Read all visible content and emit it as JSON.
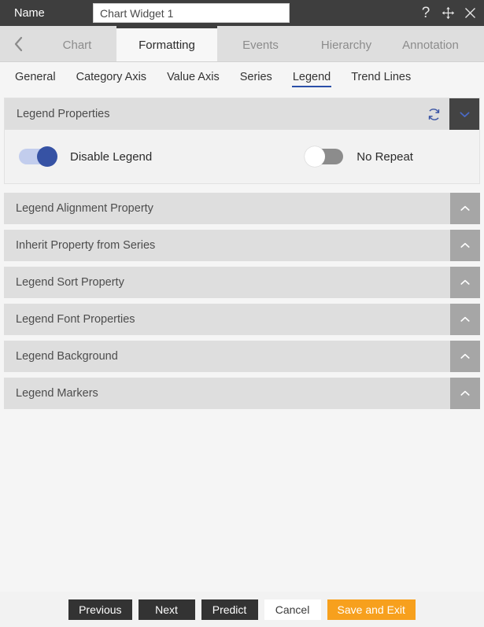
{
  "titlebar": {
    "name_label": "Name",
    "widget_name": "Chart Widget 1",
    "widget_name_placeholder": "Chart Widget 1",
    "icons": {
      "help": "?",
      "move": "move-icon",
      "close": "close-icon"
    }
  },
  "tabs": {
    "prev_arrow": "chevron-left-icon",
    "next_arrow": "chevron-right-icon",
    "items": [
      {
        "label": "Chart",
        "active": false
      },
      {
        "label": "Formatting",
        "active": true
      },
      {
        "label": "Events",
        "active": false
      },
      {
        "label": "Hierarchy",
        "active": false
      },
      {
        "label": "Annotation",
        "active": false
      }
    ]
  },
  "subtabs": {
    "items": [
      {
        "label": "General",
        "active": false
      },
      {
        "label": "Category Axis",
        "active": false
      },
      {
        "label": "Value Axis",
        "active": false
      },
      {
        "label": "Series",
        "active": false
      },
      {
        "label": "Legend",
        "active": true
      },
      {
        "label": "Trend Lines",
        "active": false
      }
    ]
  },
  "legend_properties": {
    "title": "Legend Properties",
    "refresh_icon": "refresh-icon",
    "collapse_icon": "chevron-down-icon",
    "toggles": [
      {
        "label": "Disable Legend",
        "state": "on"
      },
      {
        "label": "No Repeat",
        "state": "off"
      }
    ]
  },
  "sections": [
    {
      "label": "Legend Alignment Property",
      "expand_icon": "chevron-up-icon"
    },
    {
      "label": "Inherit Property from Series",
      "expand_icon": "chevron-up-icon"
    },
    {
      "label": "Legend Sort Property",
      "expand_icon": "chevron-up-icon"
    },
    {
      "label": "Legend Font Properties",
      "expand_icon": "chevron-up-icon"
    },
    {
      "label": "Legend Background",
      "expand_icon": "chevron-up-icon"
    },
    {
      "label": "Legend Markers",
      "expand_icon": "chevron-up-icon"
    }
  ],
  "footer": {
    "buttons": [
      {
        "label": "Previous",
        "style": "dark"
      },
      {
        "label": "Next",
        "style": "dark"
      },
      {
        "label": "Predict",
        "style": "dark"
      },
      {
        "label": "Cancel",
        "style": "light"
      },
      {
        "label": "Save and Exit",
        "style": "accent"
      }
    ]
  },
  "colors": {
    "titlebar_bg": "#3e3e3e",
    "accent_orange": "#f7a01d",
    "accent_blue": "#2a4fa8",
    "toggle_on": "#3652a4",
    "panel_header": "#dedede"
  }
}
